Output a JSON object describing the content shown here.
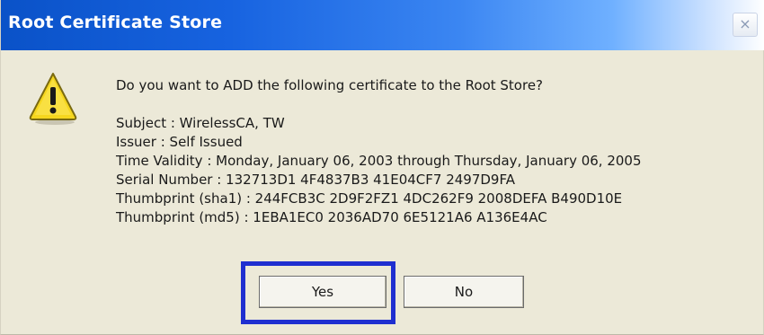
{
  "window": {
    "title": "Root Certificate Store",
    "close_glyph": "×"
  },
  "icon": {
    "name": "warning-icon",
    "glyph": "!",
    "color": "#f5d61e"
  },
  "message": {
    "question": "Do you want to ADD the following certificate to the Root Store?",
    "subject": "Subject : WirelessCA, TW",
    "issuer": "Issuer : Self Issued",
    "validity": "Time Validity : Monday, January 06, 2003 through Thursday, January 06, 2005",
    "serial": "Serial Number : 132713D1 4F4837B3 41E04CF7 2497D9FA",
    "thumb_sha1": "Thumbprint (sha1) : 244FCB3C 2D9F2FZ1 4DC262F9 2008DEFA B490D10E",
    "thumb_md5": "Thumbprint (md5) : 1EBA1EC0 2036AD70 6E5121A6 A136E4AC"
  },
  "buttons": {
    "yes_label": "Yes",
    "no_label": "No"
  },
  "colors": {
    "titlebar_start": "#0a52c8",
    "dialog_bg": "#ece9d8",
    "highlight": "#1f2fd0"
  }
}
